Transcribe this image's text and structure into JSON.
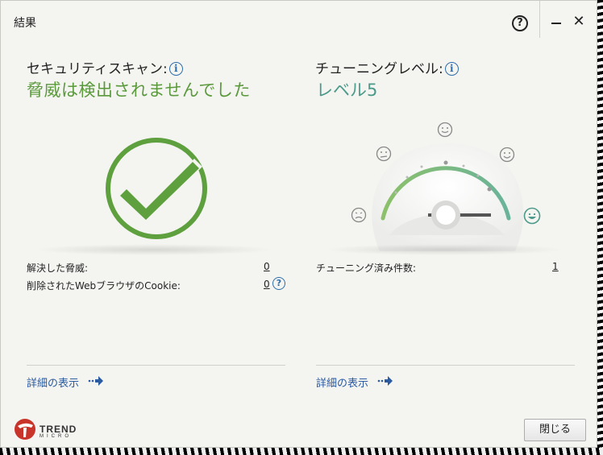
{
  "window": {
    "title": "結果"
  },
  "security_scan": {
    "heading": "セキュリティスキャン:",
    "status": "脅威は検出されませんでした",
    "stats": [
      {
        "label": "解決した脅威:",
        "value": "0"
      },
      {
        "label": "削除されたWebブラウザのCookie:",
        "value": "0"
      }
    ],
    "details_link": "詳細の表示"
  },
  "tuning": {
    "heading": "チューニングレベル:",
    "level": "レベル5",
    "level_value": 5,
    "level_max": 5,
    "stats": [
      {
        "label": "チューニング済み件数:",
        "value": "1"
      }
    ],
    "details_link": "詳細の表示"
  },
  "footer": {
    "brand": "TREND",
    "brand_sub": "MICRO",
    "close_label": "閉じる"
  },
  "colors": {
    "status_green": "#5b9a3c",
    "tuning_teal": "#4c9a8a",
    "link_blue": "#2a5aa0",
    "brand_red": "#c8342a"
  }
}
